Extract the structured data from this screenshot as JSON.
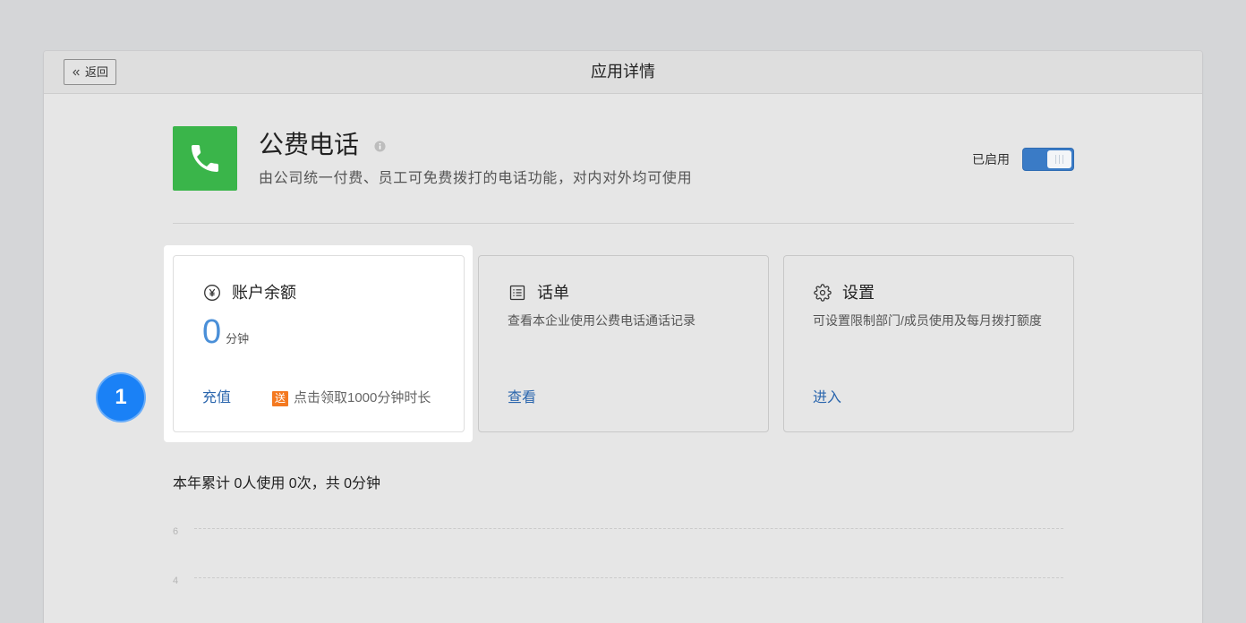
{
  "header": {
    "back_button": {
      "icon": "double-chevron-left-icon",
      "label": "返回"
    },
    "title": "应用详情"
  },
  "app": {
    "icon": "phone-icon",
    "info_icon": "info-icon",
    "name": "公费电话",
    "description": "由公司统一付费、员工可免费拨打的电话功能，对内对外均可使用",
    "status_label": "已启用",
    "enabled": true
  },
  "cards": [
    {
      "icon": "yen-circle-icon",
      "title": "账户余额",
      "balance_value": 0,
      "balance_unit": "分钟",
      "action": "充值",
      "promo_badge": "送",
      "promo_text": "点击领取1000分钟时长"
    },
    {
      "icon": "list-icon",
      "title": "话单",
      "description": "查看本企业使用公费电话通话记录",
      "action": "查看"
    },
    {
      "icon": "gear-icon",
      "title": "设置",
      "description": "可设置限制部门/成员使用及每月拨打额度",
      "action": "进入"
    }
  ],
  "tour": {
    "step_number": "1"
  },
  "usage_summary": "本年累计 0人使用 0次，共 0分钟",
  "usage_chart": {
    "y_ticks": [
      6,
      4
    ],
    "grid": true
  },
  "colors": {
    "app_icon_bg": "#3ab54a",
    "toggle_on": "#3a7bc6",
    "balance_value": "#4a8fd8",
    "accent_link": "#2b66ad",
    "promo_badge": "#f47920",
    "tour_step": "#1a81f6"
  }
}
